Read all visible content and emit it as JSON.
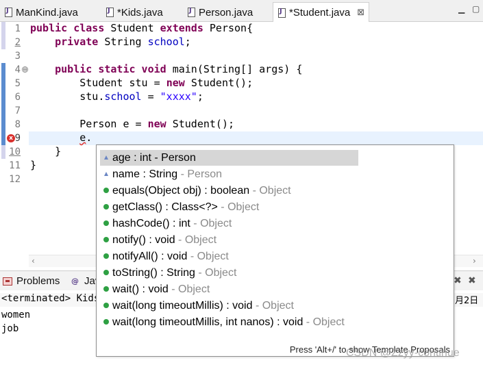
{
  "tabs": [
    {
      "label": "ManKind.java",
      "active": false
    },
    {
      "label": "*Kids.java",
      "active": false
    },
    {
      "label": "Person.java",
      "active": false
    },
    {
      "label": "*Student.java",
      "active": true
    }
  ],
  "tab_close_glyph": "⊠",
  "editor": {
    "line_numbers": [
      "1",
      "2",
      "3",
      "4",
      "5",
      "6",
      "7",
      "8",
      "9",
      "10",
      "11",
      "12"
    ],
    "fold_marker": "⊖",
    "error_marker": "x",
    "lines": [
      {
        "kw1": "public class ",
        "t1": "Student ",
        "kw2": "extends ",
        "t2": "Person{"
      },
      {
        "indent": "    ",
        "kw1": "private ",
        "t1": "String ",
        "fld": "school",
        "t2": ";"
      },
      {},
      {
        "indent": "    ",
        "kw1": "public static void ",
        "t1": "main(String[] args) {"
      },
      {
        "indent": "        ",
        "t1": "Student stu = ",
        "kw1": "new ",
        "t2": "Student();"
      },
      {
        "indent": "        ",
        "t1": "stu.",
        "fld": "school",
        "t2": " = ",
        "str": "\"xxxx\"",
        "t3": ";"
      },
      {},
      {
        "indent": "        ",
        "t1": "Person e = ",
        "kw1": "new ",
        "t2": "Student();"
      },
      {
        "indent": "        ",
        "t1": "e",
        "t2": "."
      },
      {
        "indent": "    ",
        "t1": "}"
      },
      {
        "t1": "}"
      },
      {}
    ]
  },
  "content_assist": {
    "items": [
      {
        "icon": "field",
        "text": "age : int - Person",
        "owner": "",
        "selected": true
      },
      {
        "icon": "field",
        "text": "name : String",
        "owner": " - Person",
        "selected": false
      },
      {
        "icon": "method",
        "text": "equals(Object obj) : boolean",
        "owner": " - Object",
        "selected": false
      },
      {
        "icon": "method",
        "text": "getClass() : Class<?>",
        "owner": " - Object",
        "selected": false
      },
      {
        "icon": "method",
        "text": "hashCode() : int",
        "owner": " - Object",
        "selected": false
      },
      {
        "icon": "method",
        "text": "notify() : void",
        "owner": " - Object",
        "selected": false
      },
      {
        "icon": "method",
        "text": "notifyAll() : void",
        "owner": " - Object",
        "selected": false
      },
      {
        "icon": "method",
        "text": "toString() : String",
        "owner": " - Object",
        "selected": false
      },
      {
        "icon": "method",
        "text": "wait() : void",
        "owner": " - Object",
        "selected": false
      },
      {
        "icon": "method",
        "text": "wait(long timeoutMillis) : void",
        "owner": " - Object",
        "selected": false
      },
      {
        "icon": "method",
        "text": "wait(long timeoutMillis, int nanos) : void",
        "owner": " - Object",
        "selected": false
      }
    ],
    "hint": "Press 'Alt+/' to show Template Proposals"
  },
  "panel": {
    "problems_label": "Problems",
    "javadoc_label": "Jav",
    "terminated": "<terminated> Kids",
    "date_fragment": "月2日",
    "output_lines": [
      "women",
      "job"
    ]
  },
  "watermark": "CSDN @Zzyy-continue",
  "colors": {
    "keyword": "#7f0055",
    "field": "#0000c0",
    "string": "#2a00ff",
    "current_line": "#e8f2fe",
    "selection": "#d6d6d6",
    "method_icon": "#2ea043"
  }
}
